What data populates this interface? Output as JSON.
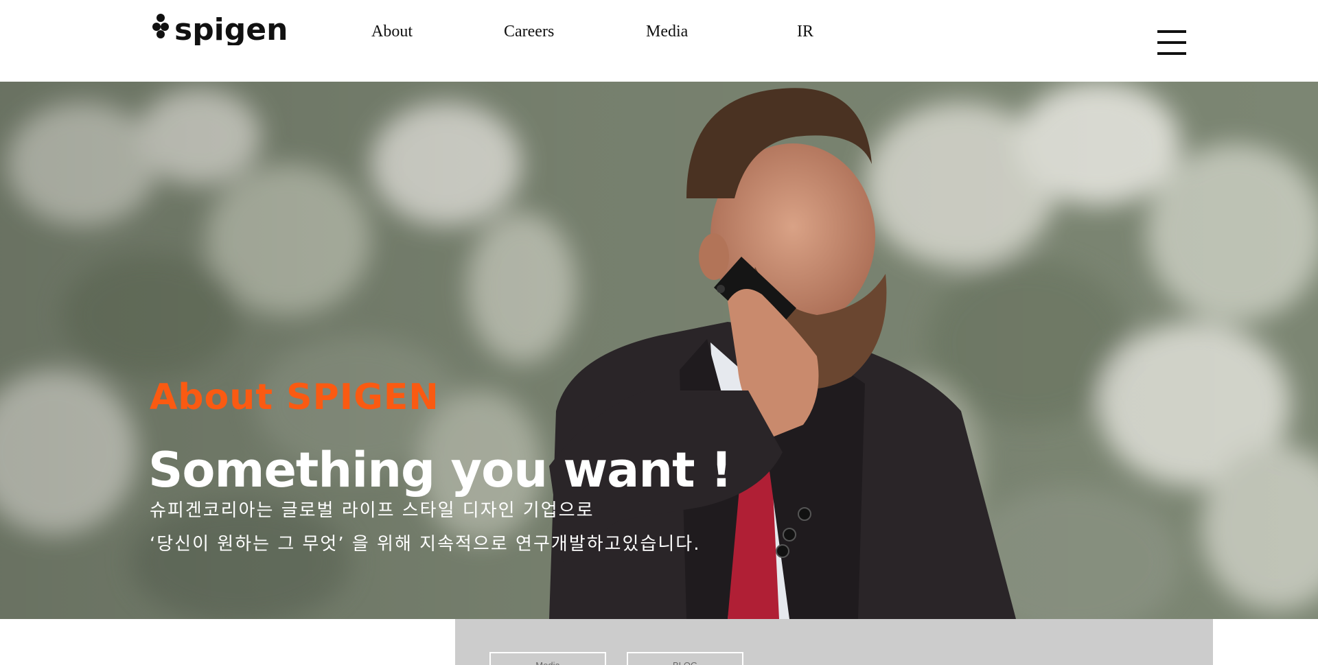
{
  "header": {
    "brand": "spigen",
    "nav": [
      {
        "label": "About"
      },
      {
        "label": "Careers"
      },
      {
        "label": "Media"
      },
      {
        "label": "IR"
      }
    ],
    "menu_icon": "hamburger-menu-icon"
  },
  "hero": {
    "eyebrow": "About SPIGEN",
    "title": "Something you want !",
    "desc_line1": "슈피겐코리아는 글로벌 라이프 스타일 디자인 기업으로",
    "desc_line2": "‘당신이 원하는 그 무엇’ 을 위해 지속적으로 연구개발하고있습니다."
  },
  "strip": {
    "tabs": [
      {
        "label": "Media"
      },
      {
        "label": "BLOG"
      }
    ]
  },
  "colors": {
    "accent": "#fa5a12",
    "header_bg": "#ffffff",
    "strip_bg": "#cccccc"
  }
}
